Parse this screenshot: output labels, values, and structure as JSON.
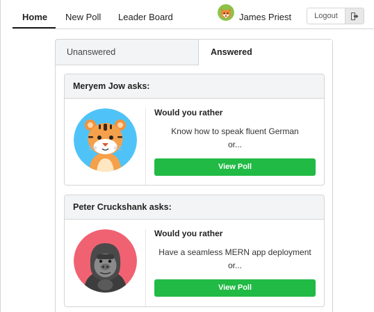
{
  "nav": {
    "items": [
      {
        "label": "Home",
        "active": true
      },
      {
        "label": "New Poll",
        "active": false
      },
      {
        "label": "Leader Board",
        "active": false
      }
    ],
    "user": {
      "name": "James Priest",
      "avatar_icon": "fox-avatar-icon"
    },
    "logout_label": "Logout",
    "logout_icon": "sign-out-icon"
  },
  "tabs": [
    {
      "label": "Unanswered",
      "active": false
    },
    {
      "label": "Answered",
      "active": true
    }
  ],
  "questions": [
    {
      "header": "Meryem Jow asks:",
      "avatar_icon": "tiger-avatar-icon",
      "title": "Would you rather",
      "option": "Know how to speak fluent German",
      "or": "or...",
      "button": "View Poll"
    },
    {
      "header": "Peter Cruckshank asks:",
      "avatar_icon": "gorilla-avatar-icon",
      "title": "Would you rather",
      "option": "Have a seamless MERN app deployment",
      "or": "or...",
      "button": "View Poll"
    }
  ],
  "colors": {
    "accent_green": "#21ba45",
    "tab_inactive_bg": "#f3f4f5",
    "border": "#d4d4d5",
    "tiger_bg": "#4fc3f7",
    "gorilla_bg": "#f06272"
  }
}
